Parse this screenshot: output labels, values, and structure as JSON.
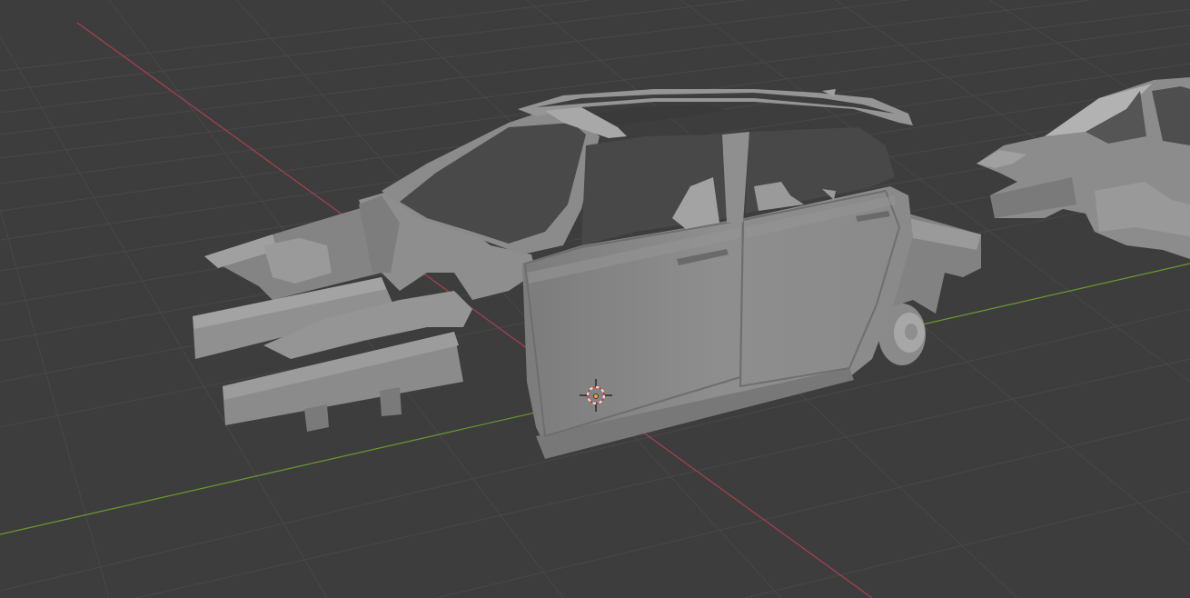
{
  "viewport": {
    "background_color": "#3d3d3d",
    "grid_color": "#4a4a4a",
    "x_axis_color": "#a8404c",
    "y_axis_color": "#6d9a2e"
  },
  "scene_objects": [
    {
      "name": "car-body-shell",
      "shading": "solid",
      "base_color": "#8d8d8d"
    },
    {
      "name": "car-body-shell-duplicate",
      "shading": "solid",
      "base_color": "#8d8d8d"
    }
  ],
  "gizmos": {
    "cursor_3d": {
      "icon": "3d-cursor-icon",
      "ring_colors": [
        "#e6e6e6",
        "#d63b2e"
      ]
    },
    "origin": {
      "icon": "origin-point-icon",
      "color": "#f0a040"
    }
  }
}
